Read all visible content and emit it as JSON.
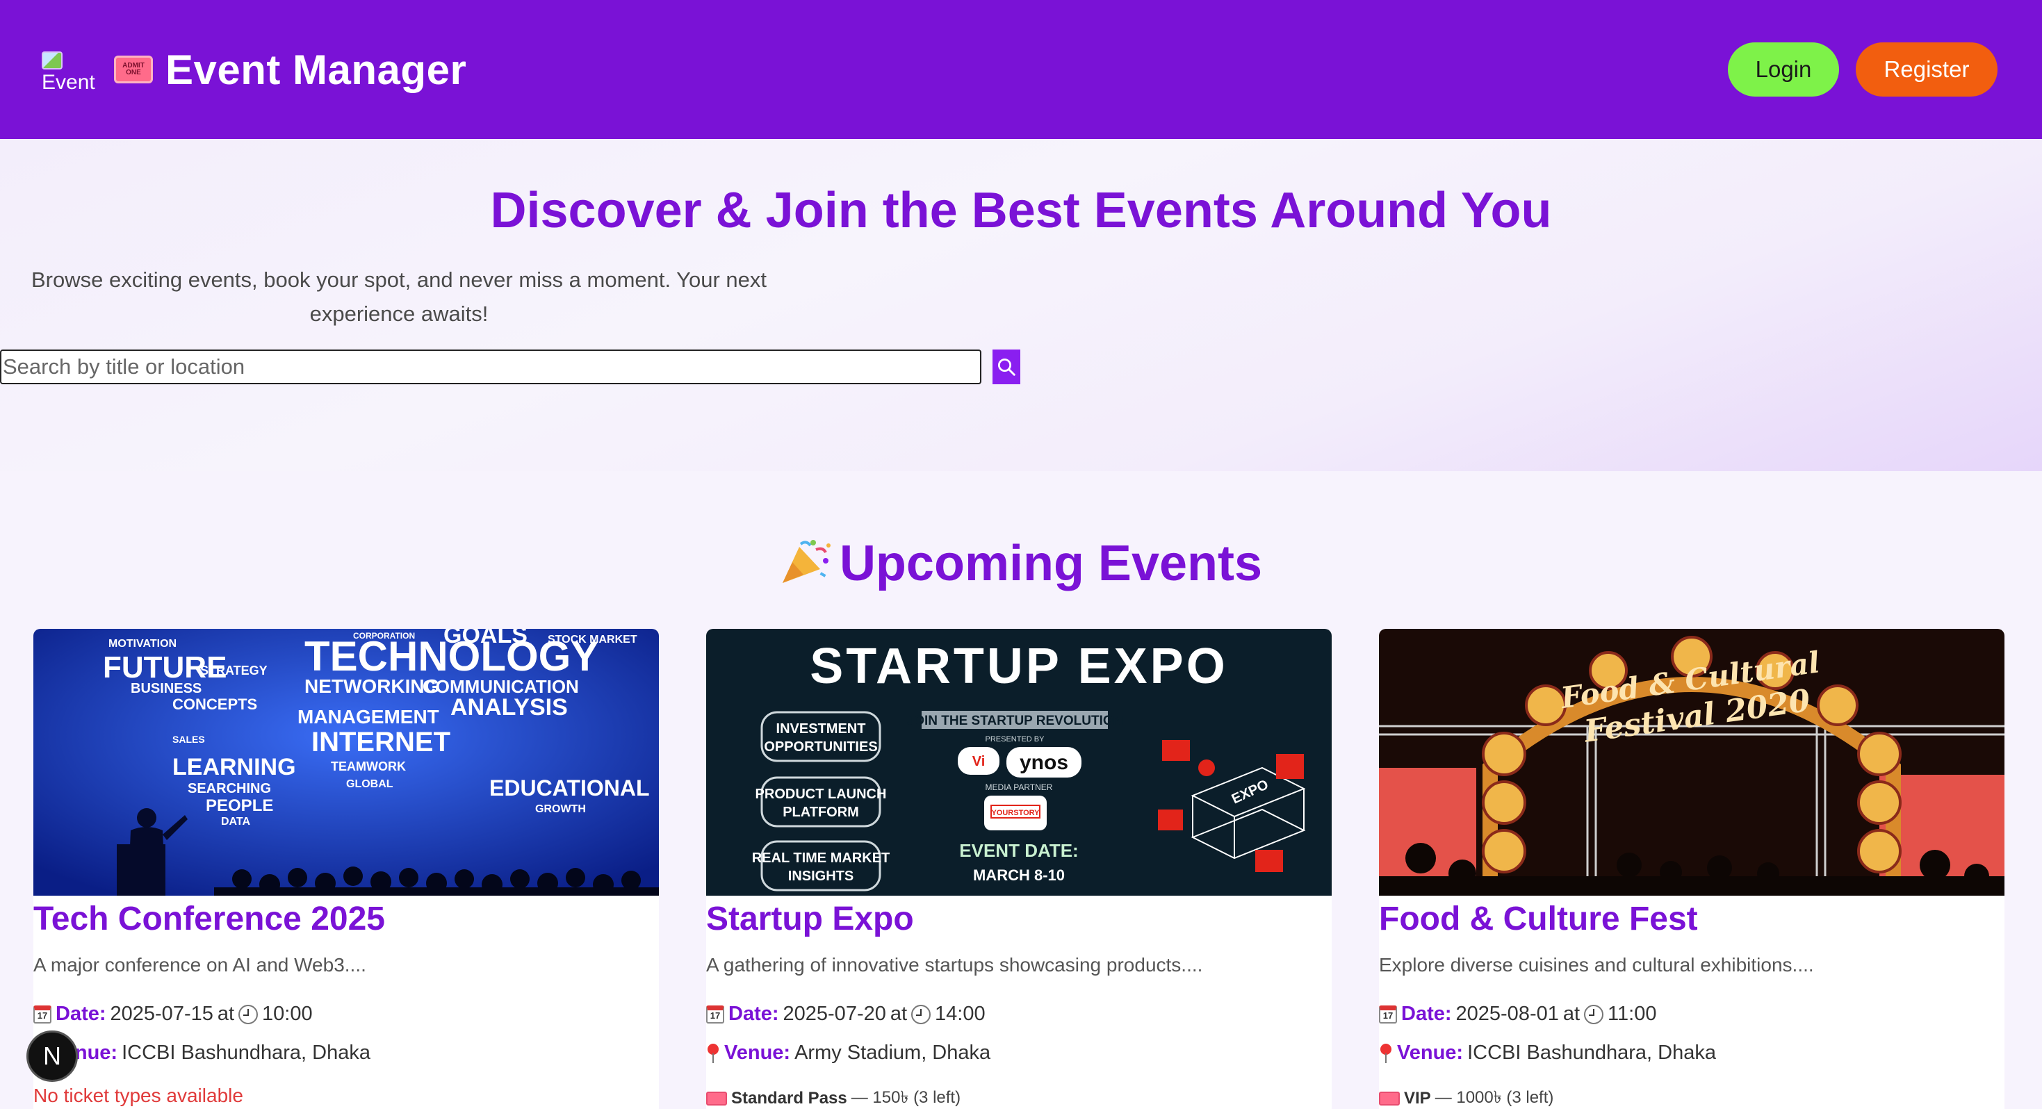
{
  "header": {
    "logo_alt": "Event",
    "title": "Event Manager",
    "login_label": "Login",
    "register_label": "Register",
    "ticket_emoji_text": "ADMIT ONE"
  },
  "hero": {
    "title": "Discover & Join the Best Events Around You",
    "subtitle_line1": "Browse exciting events, book your spot, and never miss a moment. Your next",
    "subtitle_line2": "experience awaits!",
    "search_placeholder": "Search by title or location"
  },
  "section": {
    "title": "Upcoming Events"
  },
  "events": [
    {
      "title": "Tech Conference 2025",
      "description": "A major conference on AI and Web3....",
      "date_label": "Date:",
      "date": "2025-07-15",
      "at": "at",
      "time": "10:00",
      "venue_label": "Venue:",
      "venue": "ICCBI Bashundhara, Dhaka",
      "tickets": "No ticket types available",
      "image": {
        "words": [
          "MOTIVATION",
          "FUTURE",
          "STRATEGY",
          "BUSINESS",
          "CONCEPTS",
          "TECHNOLOGY",
          "GOALS",
          "NETWORKING",
          "COMMUNICATION",
          "ANALYSIS",
          "MANAGEMENT",
          "INTERNET",
          "LEARNING",
          "SEARCHING",
          "PEOPLE",
          "DATA",
          "EDUCATIONAL",
          "GROWTH",
          "TEAMWORK",
          "GLOBAL",
          "STOCK MARKET",
          "CORPORATION",
          "SALES"
        ]
      }
    },
    {
      "title": "Startup Expo",
      "description": "A gathering of innovative startups showcasing products....",
      "date_label": "Date:",
      "date": "2025-07-20",
      "at": "at",
      "time": "14:00",
      "venue_label": "Venue:",
      "venue": "Army Stadium, Dhaka",
      "ticket_name": "Standard Pass",
      "ticket_detail": "— 150৳ (3 left)",
      "image": {
        "headline": "STARTUP EXPO",
        "pill1a": "INVESTMENT",
        "pill1b": "OPPORTUNITIES",
        "pill2a": "PRODUCT LAUNCH",
        "pill2b": "PLATFORM",
        "pill3a": "REAL TIME MARKET",
        "pill3b": "INSIGHTS",
        "banner": "JOIN THE STARTUP REVOLUTION",
        "presented": "PRESENTED BY",
        "vi": "Vi",
        "ynos": "ynos",
        "media": "MEDIA PARTNER",
        "yourstory": "YOURSTORY",
        "event_date": "EVENT DATE:",
        "event_range": "MARCH 8-10",
        "expo_tag": "EXPO"
      }
    },
    {
      "title": "Food & Culture Fest",
      "description": "Explore diverse cuisines and cultural exhibitions....",
      "date_label": "Date:",
      "date": "2025-08-01",
      "at": "at",
      "time": "11:00",
      "venue_label": "Venue:",
      "venue": "ICCBI Bashundhara, Dhaka",
      "ticket_name": "VIP",
      "ticket_detail": "— 1000৳ (3 left)",
      "image": {
        "sign_line1": "Food & Cultural",
        "sign_line2": "Festival 2020"
      }
    }
  ],
  "next_badge": "N"
}
